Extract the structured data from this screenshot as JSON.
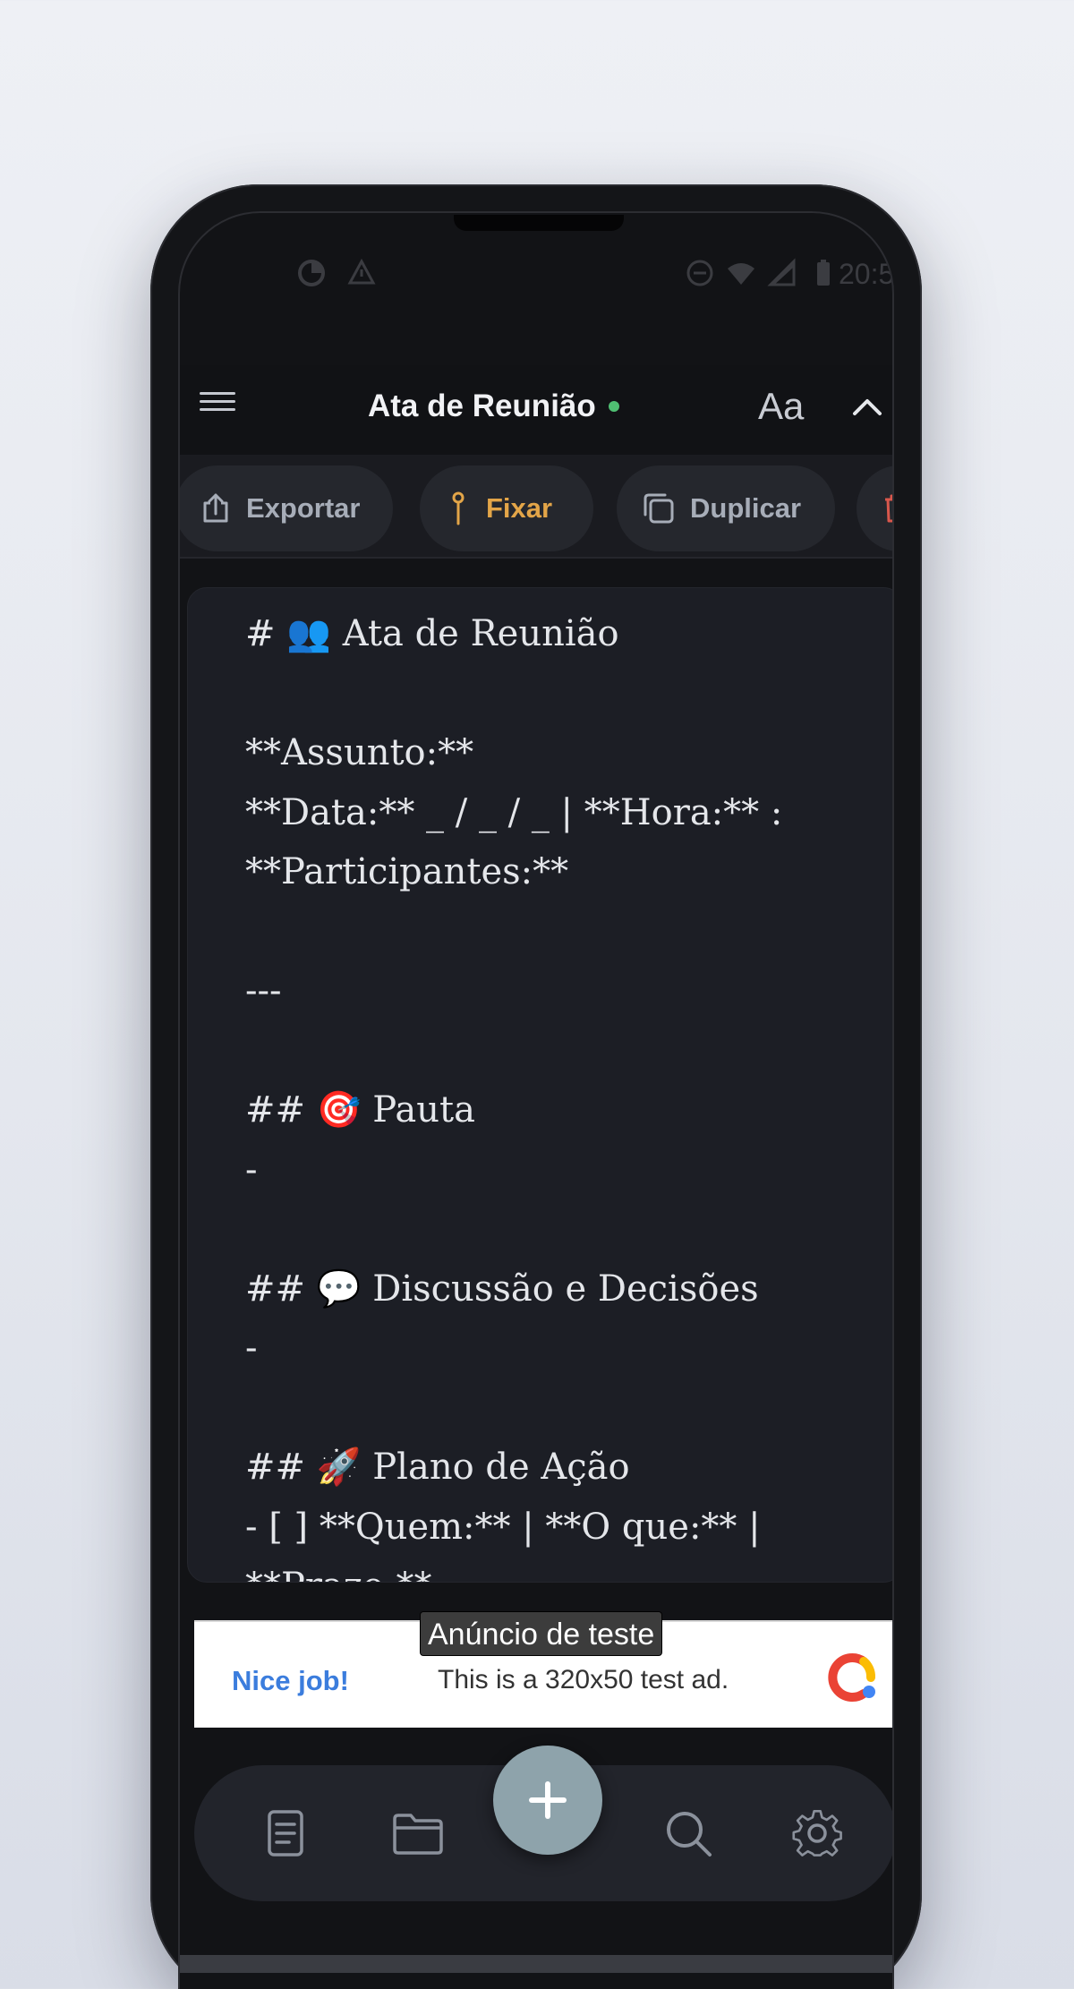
{
  "app": {
    "title": "Ata de Reunião",
    "font_button_label": "Aa"
  },
  "status_bar": {
    "time": "20:5"
  },
  "toolbar": {
    "export_label": "Exportar",
    "pin_label": "Fixar",
    "duplicate_label": "Duplicar"
  },
  "note": {
    "lines": [
      "# 👥 Ata de Reunião",
      "",
      "**Assunto:**",
      "**Data:** _ / _ / _ | **Hora:** :",
      "**Participantes:**",
      "",
      "---",
      "",
      "## 🎯 Pauta",
      "-",
      "",
      "## 💬 Discussão e Decisões",
      "-",
      "",
      "## 🚀 Plano de Ação",
      "- [ ] **Quem:** | **O que:** |",
      "**Prazo:**"
    ]
  },
  "ad": {
    "badge": "Anúncio de teste",
    "cta": "Nice job!",
    "text": "This is a 320x50 test ad."
  },
  "icons": {
    "menu": "hamburger-menu-icon",
    "collapse": "chevron-up-icon",
    "export": "share-upload-icon",
    "pin": "pin-icon",
    "duplicate": "copy-icon",
    "delete": "trash-icon",
    "notes": "document-icon",
    "folders": "folder-icon",
    "add": "plus-icon",
    "search": "search-icon",
    "settings": "gear-icon"
  },
  "colors": {
    "accent_pin": "#e3a548",
    "saved_indicator": "#4fbf72",
    "fab": "#8ea3ab",
    "delete": "#d9574c"
  }
}
